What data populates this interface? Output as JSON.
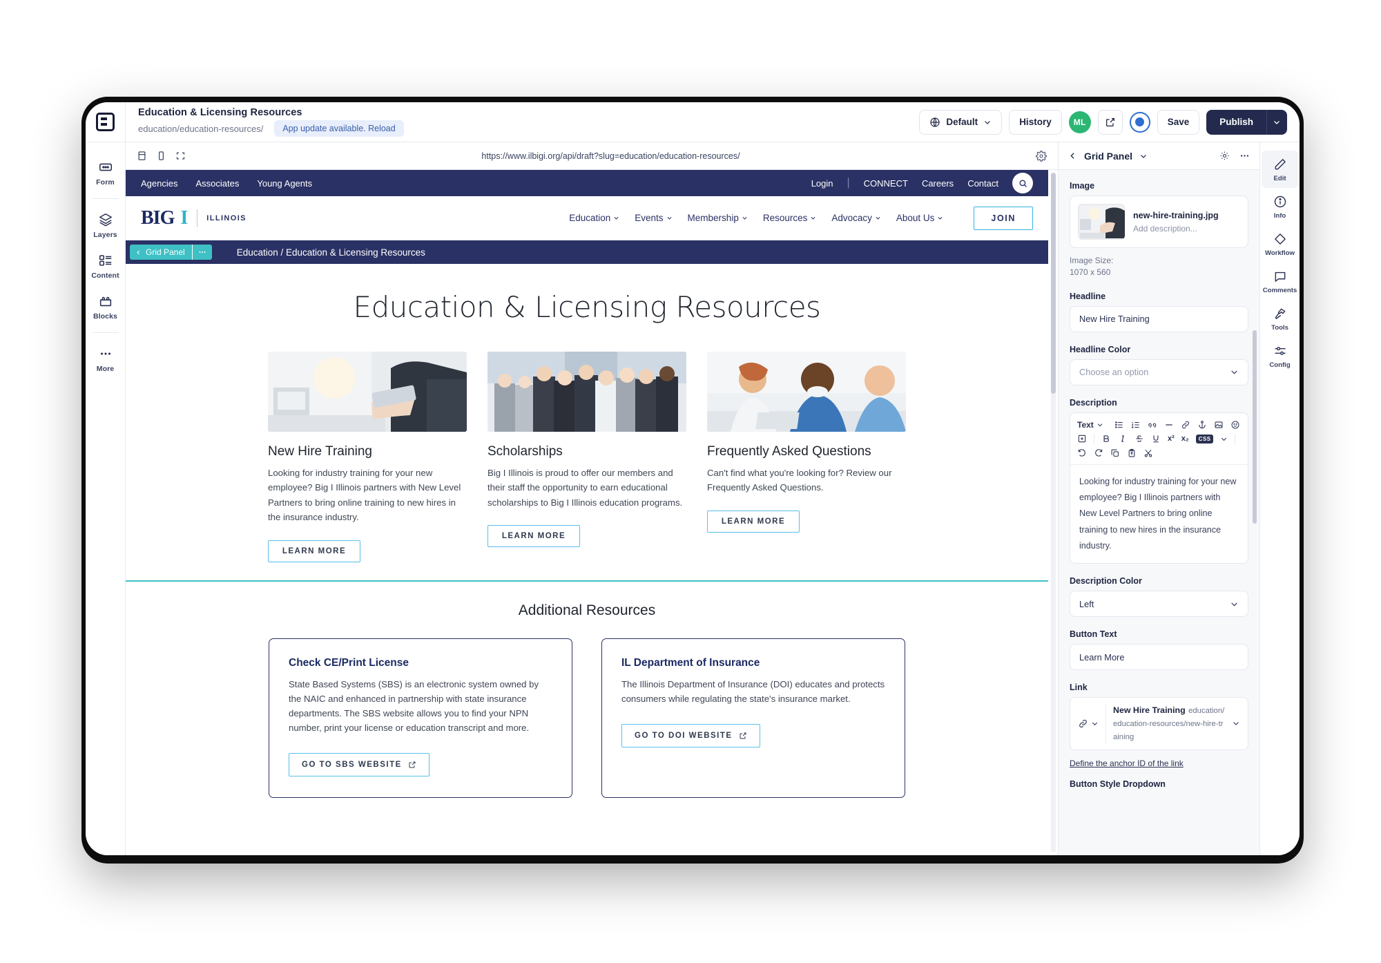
{
  "app": {
    "doc_title": "Education & Licensing Resources",
    "doc_slug": "education/education-resources/",
    "update_pill": "App update available. Reload",
    "logo_name": "brightspot-logo"
  },
  "toolbar": {
    "site_selector": "Default",
    "history": "History",
    "avatar_initials": "ML",
    "save": "Save",
    "publish": "Publish"
  },
  "left_rail": [
    {
      "label": "Form",
      "icon": "form-icon"
    },
    {
      "label": "Layers",
      "icon": "layers-icon"
    },
    {
      "label": "Content",
      "icon": "content-icon"
    },
    {
      "label": "Blocks",
      "icon": "blocks-icon"
    },
    {
      "label": "More",
      "icon": "more-icon"
    }
  ],
  "browser": {
    "url": "https://www.ilbigi.org/api/draft?slug=education/education-resources/",
    "viewport_desktop": "desktop-viewport-icon",
    "viewport_mobile": "mobile-viewport-icon",
    "viewport_fullscreen": "fullscreen-icon",
    "settings": "gear-icon"
  },
  "site": {
    "topbar_left": [
      "Agencies",
      "Associates",
      "Young Agents"
    ],
    "topbar_right": [
      "Login",
      "CONNECT",
      "Careers",
      "Contact"
    ],
    "topbar_divider": "|",
    "brand": {
      "big": "BIG",
      "i": "I",
      "state": "ILLINOIS"
    },
    "nav": [
      "Education",
      "Events",
      "Membership",
      "Resources",
      "Advocacy",
      "About Us"
    ],
    "join": "JOIN",
    "overlay_chip": "Grid Panel",
    "breadcrumb": "Education / Education & Licensing Resources",
    "page_title": "Education & Licensing Resources",
    "cards": [
      {
        "title": "New Hire Training",
        "body": "Looking for industry training for your new employee? Big I Illinois partners with New Level Partners to bring online training to new hires in the insurance industry.",
        "button": "LEARN MORE",
        "image": "man-with-tablet-photo"
      },
      {
        "title": "Scholarships",
        "body": "Big I Illinois is proud to offer our members and their staff the opportunity to earn educational scholarships to Big I Illinois education programs.",
        "button": "LEARN MORE",
        "image": "business-team-group-photo"
      },
      {
        "title": "Frequently Asked Questions",
        "body": "Can't find what you're looking for? Review our Frequently Asked Questions.",
        "button": "LEARN MORE",
        "image": "colleagues-meeting-photo"
      }
    ],
    "additional_title": "Additional Resources",
    "resources": [
      {
        "title": "Check CE/Print License",
        "body": "State Based Systems (SBS) is an electronic system owned by the NAIC and enhanced in partnership with state insurance departments. The SBS website allows you to find your NPN number, print your license or education transcript and more.",
        "button": "GO TO SBS WEBSITE"
      },
      {
        "title": "IL Department of Insurance",
        "body": "The Illinois Department of Insurance (DOI) educates and protects consumers while regulating the state's insurance market.",
        "button": "GO TO DOI WEBSITE"
      }
    ]
  },
  "panel": {
    "header_title": "Grid Panel",
    "image_label": "Image",
    "asset_name": "new-hire-training.jpg",
    "asset_description_placeholder": "Add description...",
    "image_size_label": "Image Size:",
    "image_size_value": "1070 x 560",
    "headline_label": "Headline",
    "headline_value": "New Hire Training",
    "headline_color_label": "Headline Color",
    "headline_color_value": "Choose an option",
    "description_label": "Description",
    "editor_style": "Text",
    "description_value": "Looking for industry training for your new employee? Big I Illinois partners with New Level Partners to bring online training to new hires in the insurance industry.",
    "description_color_label": "Description Color",
    "description_color_value": "Left",
    "button_text_label": "Button Text",
    "button_text_value": "Learn More",
    "link_label": "Link",
    "link_title": "New Hire Training",
    "link_url": "education/education-resources/new-hire-training",
    "anchor_link": "Define the anchor ID of the link",
    "button_style_label": "Button Style Dropdown",
    "css_badge": "CSS"
  },
  "icon_rail": [
    {
      "label": "Edit",
      "icon": "pencil-icon",
      "active": true
    },
    {
      "label": "Info",
      "icon": "info-icon",
      "active": false
    },
    {
      "label": "Workflow",
      "icon": "diamond-icon",
      "active": false
    },
    {
      "label": "Comments",
      "icon": "comment-icon",
      "active": false
    },
    {
      "label": "Tools",
      "icon": "hammer-icon",
      "active": false
    },
    {
      "label": "Config",
      "icon": "sliders-icon",
      "active": false
    }
  ],
  "colors": {
    "navy": "#2a3164",
    "teal": "#3ec0c4",
    "publish": "#232a4d",
    "avatar_green": "#2bb673",
    "link_blue": "#57c0e8"
  }
}
